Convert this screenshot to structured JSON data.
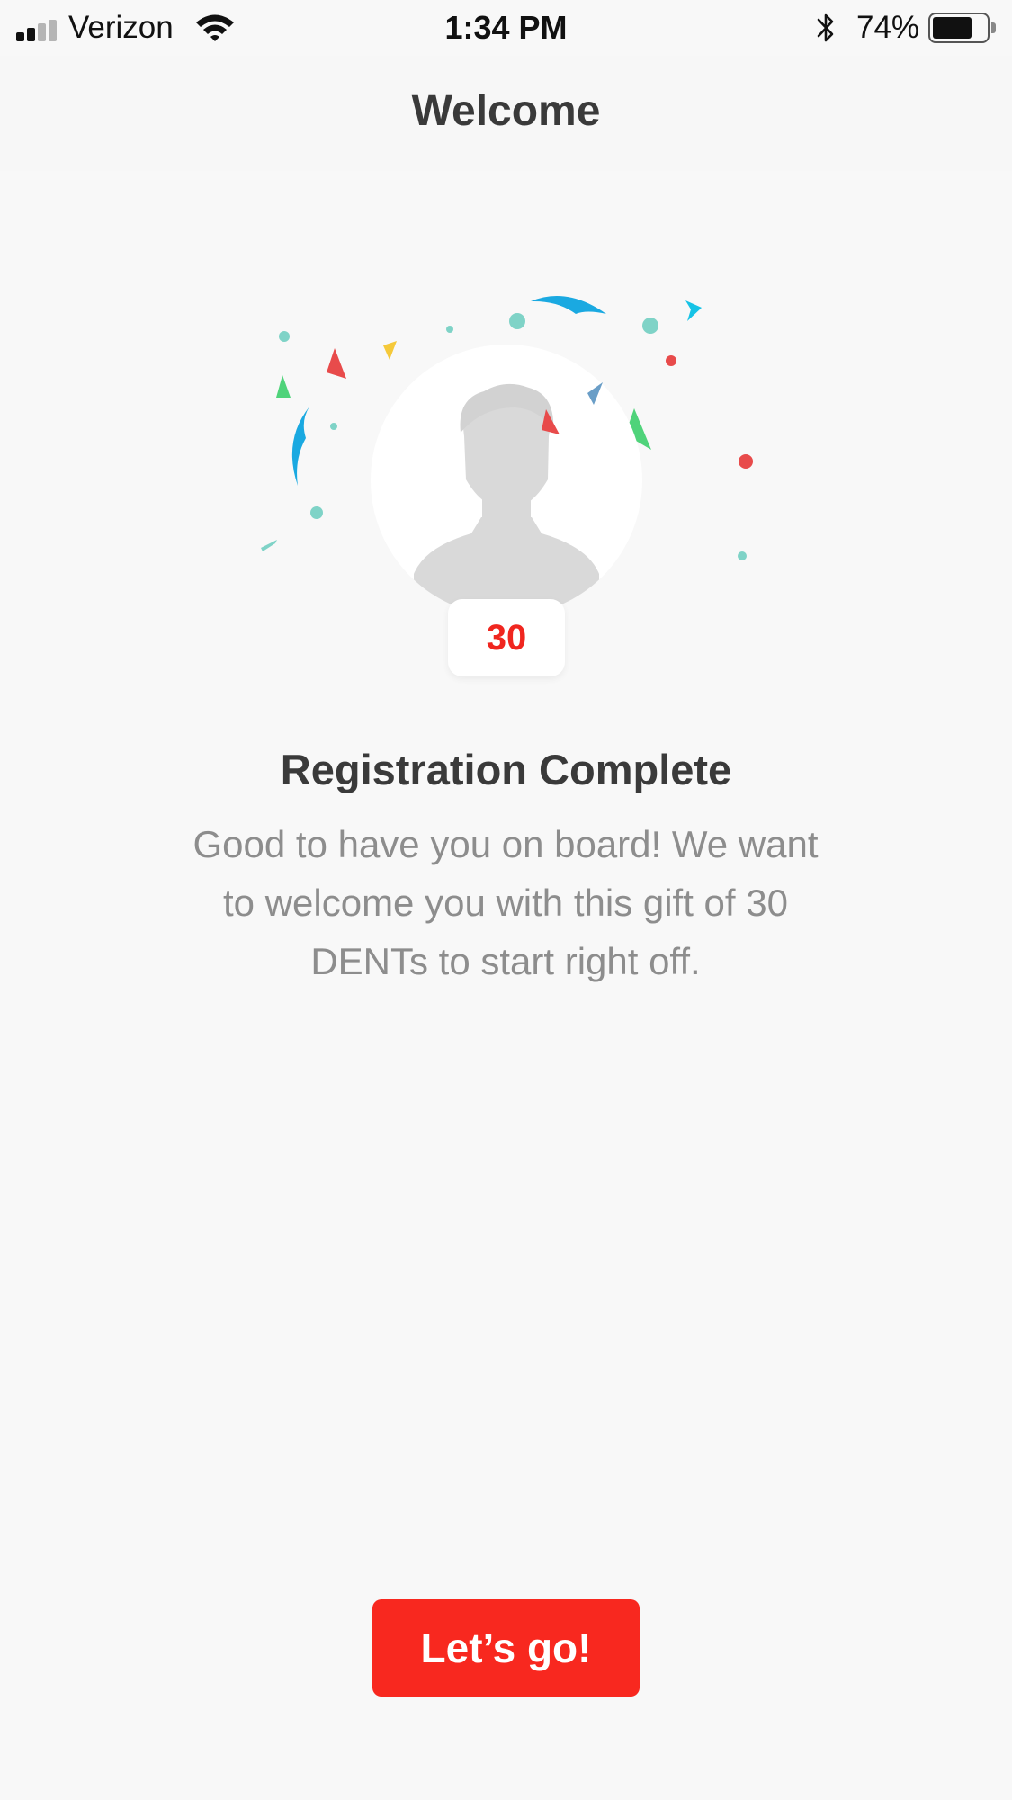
{
  "status_bar": {
    "carrier": "Verizon",
    "time": "1:34 PM",
    "battery_percent": "74%",
    "battery_level": 0.74,
    "signal_bars": 2,
    "signal_total_bars": 4,
    "icons": [
      "signal-icon",
      "wifi-icon",
      "bluetooth-icon",
      "battery-icon"
    ]
  },
  "nav": {
    "title": "Welcome"
  },
  "illustration": {
    "avatar_icon": "user-silhouette-icon",
    "badge_value": "30",
    "confetti_colors": [
      "#7fd3c7",
      "#e84b4b",
      "#4fd37a",
      "#1aa9e1",
      "#f5c93a",
      "#6a9ec7",
      "#16c3e6"
    ]
  },
  "content": {
    "headline": "Registration Complete",
    "message_lines": [
      "Good to have you on board! We want",
      "to welcome you with this gift of 30",
      "DENTs to start right off."
    ]
  },
  "cta": {
    "label": "Let’s go!"
  },
  "colors": {
    "accent": "#f8281f",
    "badge_text": "#f0261f",
    "background": "#f8f8f8",
    "title_text": "#3a3a3a",
    "body_text": "#8d8d8d"
  }
}
